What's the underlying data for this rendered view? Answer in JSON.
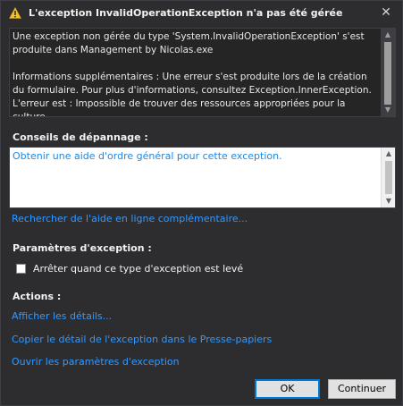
{
  "dialog": {
    "title": "L'exception InvalidOperationException n'a pas été gérée",
    "close_label": "✕"
  },
  "message": {
    "paragraph1": "Une exception non gérée du type 'System.InvalidOperationException' s'est produite dans Management by Nicolas.exe",
    "paragraph2": "Informations supplémentaires : Une erreur s'est produite lors de la création du formulaire. Pour plus d'informations, consultez Exception.InnerException. L'erreur est : Impossible de trouver des ressources appropriées pour la culture"
  },
  "troubleshooting": {
    "label": "Conseils de dépannage :",
    "tip_link": "Obtenir une aide d'ordre général pour cette exception.",
    "online_help_link": "Rechercher de l'aide en ligne complémentaire..."
  },
  "exception_settings": {
    "label": "Paramètres d'exception :",
    "break_checkbox_label": "Arrêter quand ce type d'exception est levé",
    "break_checked": false
  },
  "actions": {
    "label": "Actions :",
    "items": [
      "Afficher les détails...",
      "Copier le détail de l'exception dans le Presse-papiers",
      "Ouvrir les paramètres d'exception"
    ]
  },
  "buttons": {
    "ok_label": "OK",
    "continue_label": "Continuer"
  },
  "icons": {
    "warning": "warning-triangle-icon",
    "close": "close-icon"
  },
  "colors": {
    "background": "#2d2d30",
    "link": "#3399ff",
    "warning": "#f2c12e"
  }
}
